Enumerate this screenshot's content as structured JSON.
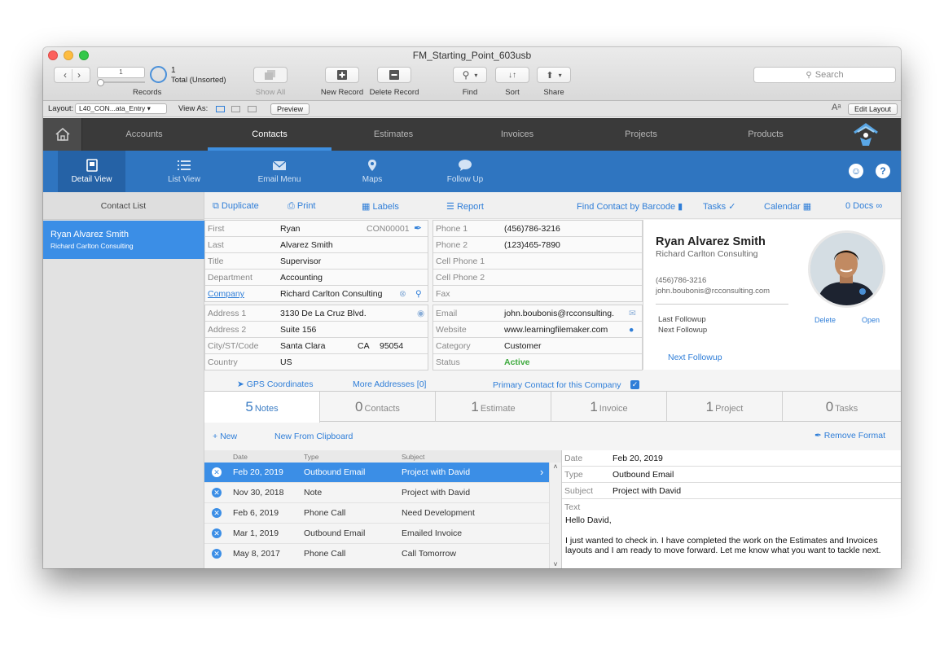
{
  "window": {
    "title": "FM_Starting_Point_603usb"
  },
  "toolbar": {
    "record_number": "1",
    "records_label": "Records",
    "total_count": "1",
    "total_text": "Total (Unsorted)",
    "show_all": "Show All",
    "new_record": "New Record",
    "delete_record": "Delete Record",
    "find": "Find",
    "sort": "Sort",
    "share": "Share",
    "search_placeholder": "Search"
  },
  "layout_bar": {
    "layout_label": "Layout:",
    "layout_value": "L40_CON...ata_Entry",
    "view_as_label": "View As:",
    "preview": "Preview",
    "edit_layout": "Edit Layout"
  },
  "top_nav": {
    "tabs": [
      "Accounts",
      "Contacts",
      "Estimates",
      "Invoices",
      "Projects",
      "Products"
    ],
    "active": "Contacts"
  },
  "sub_nav": {
    "items": [
      "Detail View",
      "List View",
      "Email Menu",
      "Maps",
      "Follow Up"
    ],
    "active": "Detail View"
  },
  "contact_list": {
    "header": "Contact List",
    "items": [
      {
        "name": "Ryan Alvarez Smith",
        "company": "Richard Carlton Consulting"
      }
    ]
  },
  "actions": {
    "duplicate": "Duplicate",
    "print": "Print",
    "labels": "Labels",
    "report": "Report",
    "find_barcode": "Find Contact by Barcode",
    "tasks": "Tasks",
    "calendar": "Calendar",
    "docs": "0 Docs"
  },
  "contact": {
    "first_label": "First",
    "first": "Ryan",
    "id": "CON00001",
    "last_label": "Last",
    "last": "Alvarez Smith",
    "title_label": "Title",
    "title": "Supervisor",
    "department_label": "Department",
    "department": "Accounting",
    "company_label": "Company",
    "company": "Richard Carlton Consulting",
    "address1_label": "Address 1",
    "address1": "3130 De La Cruz Blvd.",
    "address2_label": "Address 2",
    "address2": "Suite 156",
    "city_label": "City/ST/Code",
    "city": "Santa Clara",
    "state": "CA",
    "zip": "95054",
    "country_label": "Country",
    "country": "US",
    "phone1_label": "Phone 1",
    "phone1": "(456)786-3216",
    "phone2_label": "Phone 2",
    "phone2": "(123)465-7890",
    "cell1_label": "Cell Phone 1",
    "cell2_label": "Cell Phone 2",
    "fax_label": "Fax",
    "email_label": "Email",
    "email": "john.boubonis@rcconsulting.",
    "website_label": "Website",
    "website": "www.learningfilemaker.com",
    "category_label": "Category",
    "category": "Customer",
    "status_label": "Status",
    "status": "Active"
  },
  "card": {
    "name": "Ryan Alvarez Smith",
    "company": "Richard Carlton Consulting",
    "phone": "(456)786-3216",
    "email": "john.boubonis@rcconsulting.com",
    "last_followup": "Last Followup",
    "next_followup": "Next Followup",
    "delete": "Delete",
    "open": "Open",
    "next_followup_link": "Next Followup"
  },
  "links": {
    "gps": "GPS Coordinates",
    "more_addresses": "More Addresses [0]",
    "primary_contact": "Primary Contact for this Company"
  },
  "count_tabs": [
    {
      "num": "5",
      "label": "Notes"
    },
    {
      "num": "0",
      "label": "Contacts"
    },
    {
      "num": "1",
      "label": "Estimate"
    },
    {
      "num": "1",
      "label": "Invoice"
    },
    {
      "num": "1",
      "label": "Project"
    },
    {
      "num": "0",
      "label": "Tasks"
    }
  ],
  "notes": {
    "new": "New",
    "new_clipboard": "New From Clipboard",
    "remove_format": "Remove Format",
    "columns": [
      "Date",
      "Type",
      "Subject"
    ],
    "rows": [
      {
        "date": "Feb 20, 2019",
        "type": "Outbound Email",
        "subject": "Project with David"
      },
      {
        "date": "Nov 30, 2018",
        "type": "Note",
        "subject": "Project with David"
      },
      {
        "date": "Feb 6, 2019",
        "type": "Phone Call",
        "subject": "Need Development"
      },
      {
        "date": "Mar 1, 2019",
        "type": "Outbound Email",
        "subject": "Emailed Invoice"
      },
      {
        "date": "May 8, 2017",
        "type": "Phone Call",
        "subject": "Call Tomorrow"
      }
    ]
  },
  "note_detail": {
    "date_label": "Date",
    "date": "Feb 20, 2019",
    "type_label": "Type",
    "type": "Outbound Email",
    "subject_label": "Subject",
    "subject": "Project with David",
    "text_label": "Text",
    "greeting": "Hello David,",
    "body": "I just wanted to check in. I have completed the work on the Estimates and Invoices layouts and I am ready to move forward.  Let me know what you want to tackle next."
  }
}
